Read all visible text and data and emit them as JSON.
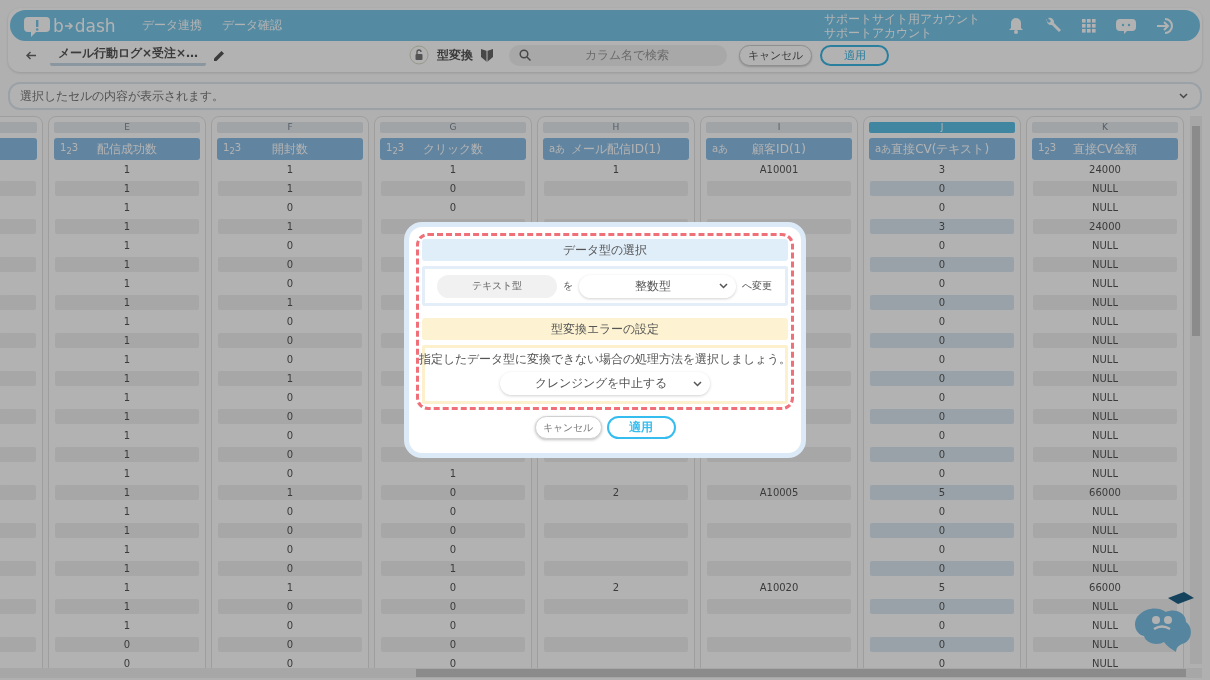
{
  "header": {
    "logo_left": "b",
    "logo_right": "dash",
    "nav": [
      "データ連携",
      "データ確認"
    ],
    "account": [
      "サポートサイト用アカウント",
      "サポートアカウント"
    ]
  },
  "toolbar": {
    "title": "メール行動ログ×受注×…",
    "mode": "型変換",
    "search_placeholder": "カラム名で検索",
    "cancel": "キャンセル",
    "apply": "適用"
  },
  "cell_viewer": {
    "placeholder": "選択したセルの内容が表示されます。"
  },
  "table": {
    "columns": [
      {
        "letter": "E",
        "type_icon": "1$_{2}$3",
        "title": "配信成功数",
        "selected": false,
        "cells": [
          "1",
          "1",
          "1",
          "1",
          "1",
          "1",
          "1",
          "1",
          "1",
          "1",
          "1",
          "1",
          "1",
          "1",
          "1",
          "1",
          "1",
          "1",
          "1",
          "1",
          "1",
          "1",
          "1",
          "1",
          "1",
          "0",
          "0"
        ]
      },
      {
        "letter": "F",
        "type_icon": "1$_{2}$3",
        "title": "開封数",
        "selected": false,
        "cells": [
          "1",
          "1",
          "0",
          "1",
          "0",
          "0",
          "0",
          "1",
          "0",
          "0",
          "0",
          "1",
          "0",
          "0",
          "0",
          "0",
          "0",
          "1",
          "0",
          "0",
          "0",
          "0",
          "1",
          "0",
          "0",
          "0",
          "0"
        ]
      },
      {
        "letter": "G",
        "type_icon": "1$_{2}$3",
        "title": "クリック数",
        "selected": false,
        "cells": [
          "1",
          "0",
          "0",
          null,
          null,
          null,
          null,
          null,
          null,
          null,
          null,
          null,
          null,
          null,
          null,
          null,
          "1",
          "0",
          "0",
          "0",
          "0",
          "1",
          "0",
          "0",
          "0",
          "0",
          "0"
        ]
      },
      {
        "letter": "H",
        "type_icon": "aあ",
        "title": "メール配信ID(1)",
        "selected": false,
        "cells": [
          "1",
          null,
          null,
          null,
          null,
          null,
          null,
          null,
          null,
          null,
          null,
          null,
          null,
          null,
          null,
          null,
          null,
          "2",
          null,
          null,
          null,
          null,
          "2",
          null,
          null,
          null,
          null
        ]
      },
      {
        "letter": "I",
        "type_icon": "aあ",
        "title": "顧客ID(1)",
        "selected": false,
        "cells": [
          "A10001",
          null,
          null,
          null,
          null,
          null,
          null,
          null,
          null,
          null,
          null,
          null,
          null,
          null,
          null,
          null,
          null,
          "A10005",
          null,
          null,
          null,
          null,
          "A10020",
          null,
          null,
          null,
          null
        ]
      },
      {
        "letter": "J",
        "type_icon": "aあ",
        "title": "直接CV(テキスト)",
        "selected": true,
        "cells": [
          "3",
          "0",
          "0",
          "3",
          "0",
          "0",
          "0",
          "0",
          "0",
          "0",
          "0",
          "0",
          "0",
          "0",
          "0",
          "0",
          "0",
          "5",
          "0",
          "0",
          "0",
          "0",
          "5",
          "0",
          "0",
          "0",
          "0"
        ]
      },
      {
        "letter": "K",
        "type_icon": "1$_{2}$3",
        "title": "直接CV金額",
        "selected": false,
        "cells": [
          "24000",
          "NULL",
          "NULL",
          "24000",
          "NULL",
          "NULL",
          "NULL",
          "NULL",
          "NULL",
          "NULL",
          "NULL",
          "NULL",
          "NULL",
          "NULL",
          "NULL",
          "NULL",
          "NULL",
          "66000",
          "NULL",
          "NULL",
          "NULL",
          "NULL",
          "66000",
          "NULL",
          "NULL",
          "NULL",
          "NULL"
        ]
      }
    ]
  },
  "dialog": {
    "type_title": "データ型の選択",
    "from_type": "テキスト型",
    "particle": "を",
    "to_type": "整数型",
    "suffix": "へ変更",
    "error_title": "型変換エラーの設定",
    "message": "指定したデータ型に変換できない場合の処理方法を選択しましょう。",
    "error_option": "クレンジングを中止する",
    "cancel": "キャンセル",
    "apply": "適用"
  }
}
